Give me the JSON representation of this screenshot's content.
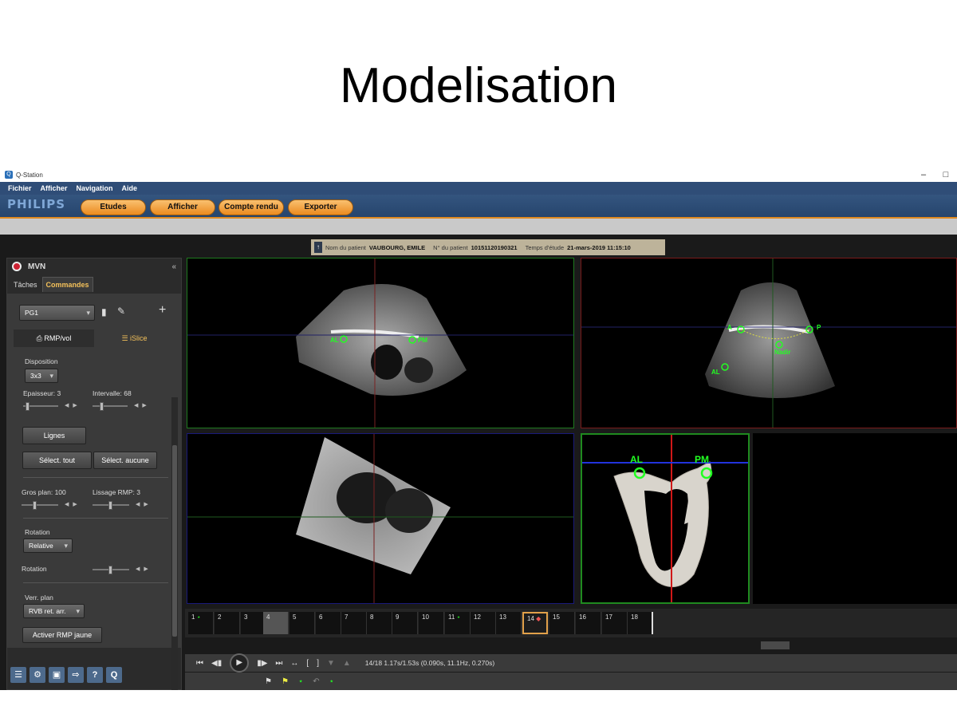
{
  "slide": {
    "title": "Modelisation"
  },
  "window": {
    "title": "Q-Station",
    "minimize": "–",
    "maximize": "□"
  },
  "menu": [
    "Fichier",
    "Afficher",
    "Navigation",
    "Aide"
  ],
  "brand": "PHILIPS",
  "tabs": [
    "Etudes",
    "Afficher",
    "Compte rendu",
    "Exporter"
  ],
  "patient": {
    "name_label": "Nom du patient",
    "name": "VAUBOURG, EMILE",
    "id_label": "N° du patient",
    "id": "10151120190321",
    "date_label": "Temps d'étude",
    "date": "21-mars-2019 11:15:10"
  },
  "panel": {
    "title": "MVN",
    "tabs": [
      "Tâches",
      "Commandes"
    ],
    "preset": "PG1",
    "subtabs": [
      "RMP/vol",
      "iSlice"
    ],
    "disposition_label": "Disposition",
    "disposition": "3x3",
    "epaisseur": "Epaisseur: 3",
    "intervalle": "Intervalle: 68",
    "lignes": "Lignes",
    "select_all": "Sélect. tout",
    "select_none": "Sélect. aucune",
    "gros_plan": "Gros plan: 100",
    "lissage": "Lissage RMP: 3",
    "rotation_label": "Rotation",
    "rotation_mode": "Relative",
    "rotation2_label": "Rotation",
    "verr_label": "Verr. plan",
    "verr_value": "RVB ret. arr.",
    "activer": "Activer RMP jaune",
    "bottom_icons": [
      "list-icon",
      "settings-icon",
      "save-icon",
      "exit-icon",
      "help-icon",
      "q-icon"
    ]
  },
  "viewports": {
    "tl": {
      "al": "AL",
      "pm": "PM"
    },
    "tr": {
      "a": "A",
      "p": "P",
      "nadir": "Nadir",
      "al": "AL"
    },
    "model": {
      "al": "AL",
      "pm": "PM"
    }
  },
  "timeline": {
    "frames": [
      "1",
      "2",
      "3",
      "4",
      "5",
      "6",
      "7",
      "8",
      "9",
      "10",
      "11",
      "12",
      "13",
      "14",
      "15",
      "16",
      "17",
      "18"
    ],
    "selected": "4",
    "current": "14"
  },
  "playback": {
    "status": "14/18  1.17s/1.53s (0.090s, 11.1Hz, 0.270s)"
  },
  "colors": {
    "accent": "#ec8b1f",
    "marker": "#22ee22",
    "plane_red": "#d01818",
    "plane_blue": "#2233dd"
  }
}
